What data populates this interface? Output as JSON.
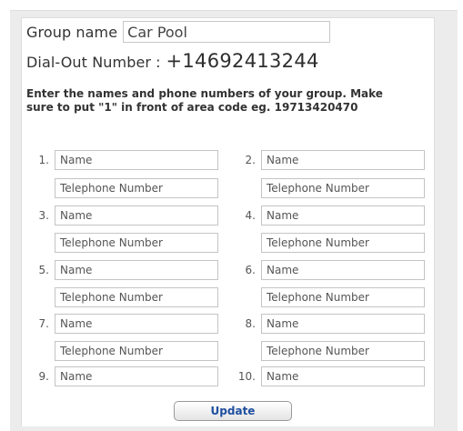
{
  "group": {
    "label": "Group name",
    "value": "Car Pool"
  },
  "dial_out": {
    "label": "Dial-Out Number",
    "separator": ":",
    "number": "+14692413244"
  },
  "instructions": "Enter the names and phone numbers of your group. Make sure to put \"1\" in front of area code eg. 19713420470",
  "members": [
    {
      "index": "1.",
      "name_placeholder": "Name",
      "phone_placeholder": "Telephone Number"
    },
    {
      "index": "2.",
      "name_placeholder": "Name",
      "phone_placeholder": "Telephone Number"
    },
    {
      "index": "3.",
      "name_placeholder": "Name",
      "phone_placeholder": "Telephone Number"
    },
    {
      "index": "4.",
      "name_placeholder": "Name",
      "phone_placeholder": "Telephone Number"
    },
    {
      "index": "5.",
      "name_placeholder": "Name",
      "phone_placeholder": "Telephone Number"
    },
    {
      "index": "6.",
      "name_placeholder": "Name",
      "phone_placeholder": "Telephone Number"
    },
    {
      "index": "7.",
      "name_placeholder": "Name",
      "phone_placeholder": "Telephone Number"
    },
    {
      "index": "8.",
      "name_placeholder": "Name",
      "phone_placeholder": "Telephone Number"
    },
    {
      "index": "9.",
      "name_placeholder": "Name"
    },
    {
      "index": "10.",
      "name_placeholder": "Name"
    }
  ],
  "update_label": "Update",
  "colors": {
    "panel_bg": "#ececec",
    "button_text": "#1f4fa0"
  }
}
